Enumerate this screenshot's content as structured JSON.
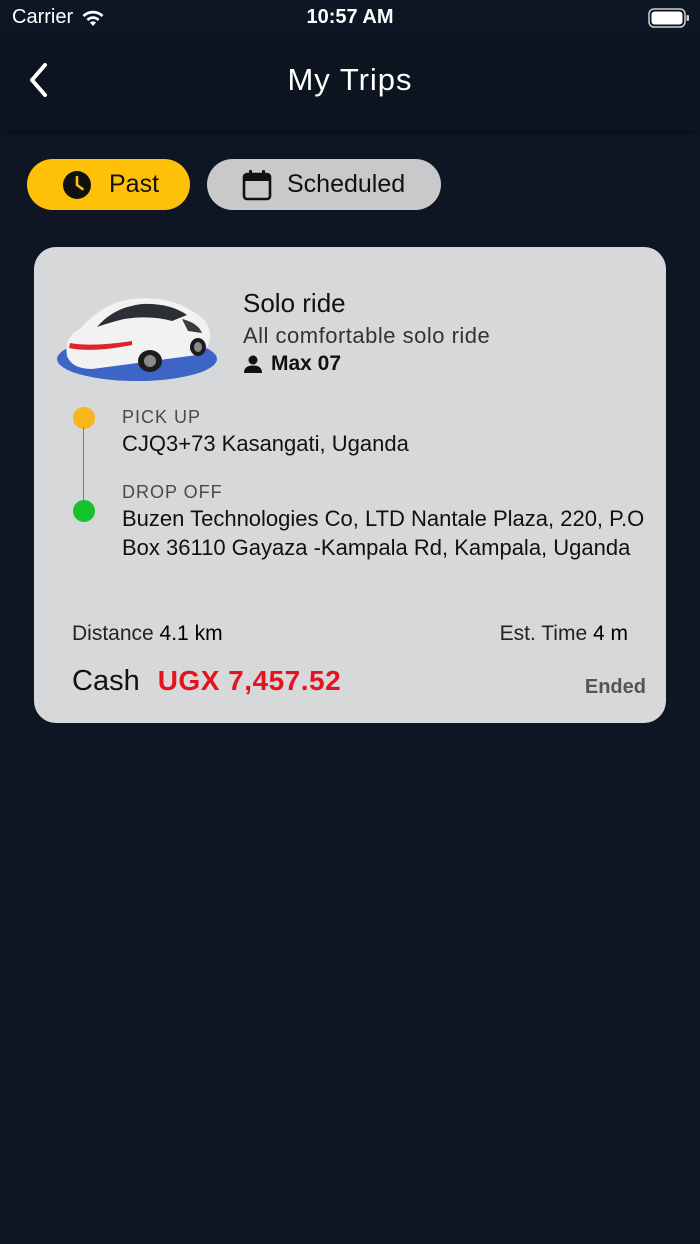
{
  "status_bar": {
    "carrier": "Carrier",
    "time": "10:57 AM"
  },
  "nav": {
    "title": "My Trips"
  },
  "tabs": [
    {
      "label": "Past",
      "icon": "clock-icon",
      "active": true
    },
    {
      "label": "Scheduled",
      "icon": "calendar-icon",
      "active": false
    }
  ],
  "trip": {
    "ride_type": "Solo ride",
    "ride_description": "All comfortable solo ride",
    "driver": "Max 07",
    "pickup_label": "PICK UP",
    "pickup_address": "CJQ3+73 Kasangati, Uganda",
    "dropoff_label": "DROP OFF",
    "dropoff_address": "Buzen Technologies Co, LTD Nantale Plaza, 220, P.O Box 36110 Gayaza -Kampala Rd, Kampala, Uganda",
    "distance_label": "Distance",
    "distance_value": "4.1 km",
    "time_label": "Est. Time",
    "time_value": "4 m",
    "payment_method": "Cash",
    "amount": "UGX 7,457.52",
    "status": "Ended"
  },
  "colors": {
    "background": "#0d1622",
    "accent": "#ffc107",
    "amount": "#e3141f",
    "pickup_dot": "#f8b71a",
    "dropoff_dot": "#16c22c"
  }
}
